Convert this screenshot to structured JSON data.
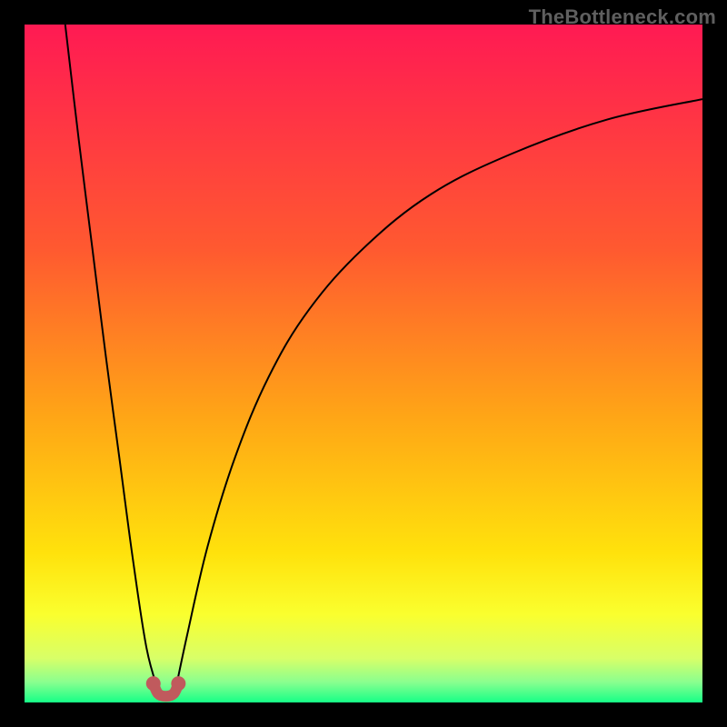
{
  "watermark": "TheBottleneck.com",
  "colors": {
    "gradient": {
      "c0": "#ff1a53",
      "c1": "#ff5930",
      "c2": "#ffa616",
      "c3": "#ffe20c",
      "c4": "#faff2e",
      "c5": "#d8ff68",
      "c6": "#8aff8f",
      "c7": "#16ff87"
    },
    "curve": "#000000",
    "marker": "#c05a5d",
    "frame": "#000000"
  },
  "chart_data": {
    "type": "line",
    "title": "",
    "xlabel": "",
    "ylabel": "",
    "xlim": [
      0,
      100
    ],
    "ylim": [
      0,
      100
    ],
    "grid": false,
    "legend": false,
    "series": [
      {
        "name": "left-branch",
        "x": [
          6,
          8,
          10,
          12,
          14,
          16,
          18,
          19.8
        ],
        "y": [
          100,
          83,
          67,
          51,
          36,
          21,
          8,
          1.5
        ]
      },
      {
        "name": "right-branch",
        "x": [
          22.2,
          24,
          27,
          31,
          36,
          42,
          50,
          60,
          72,
          86,
          100
        ],
        "y": [
          1.5,
          10,
          23,
          36,
          48,
          58,
          67,
          75,
          81,
          86,
          89
        ]
      }
    ],
    "markers": [
      {
        "name": "valley-left-dot",
        "x": 19.0,
        "y": 2.8
      },
      {
        "name": "valley-right-dot",
        "x": 22.7,
        "y": 2.8
      }
    ],
    "valley_path": {
      "x": [
        19.0,
        19.7,
        20.8,
        22.0,
        22.7
      ],
      "y": [
        2.8,
        1.3,
        0.9,
        1.3,
        2.8
      ]
    }
  }
}
